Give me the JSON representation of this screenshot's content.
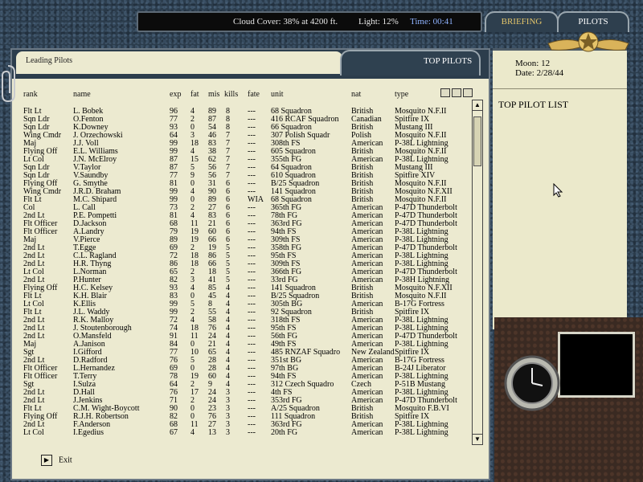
{
  "status_bar": {
    "cloud_cover": "Cloud Cover: 38% at 4200 ft.",
    "light": "Light: 12%",
    "time": "Time: 00:41"
  },
  "tabs": {
    "briefing": "BRIEFING",
    "pilots": "PILOTS"
  },
  "main": {
    "title": "Leading Pilots",
    "tab_label": "TOP PILOTS",
    "exit_label": "Exit"
  },
  "columns": [
    "rank",
    "name",
    "exp",
    "fat",
    "mis",
    "kills",
    "fate",
    "unit",
    "nat",
    "type"
  ],
  "info": {
    "moon": "Moon: 12",
    "date": "Date: 2/28/44",
    "list_title": "TOP PILOT LIST"
  },
  "pilots": [
    [
      "Flt Lt",
      "L. Bobek",
      "96",
      "4",
      "89",
      "8",
      "---",
      "68 Squadron",
      "British",
      "Mosquito N.F.II"
    ],
    [
      "Sqn Ldr",
      "O.Fenton",
      "77",
      "2",
      "87",
      "8",
      "---",
      "416 RCAF Squadron",
      "Canadian",
      "Spitfire IX"
    ],
    [
      "Sqn Ldr",
      "K.Downey",
      "93",
      "0",
      "54",
      "8",
      "---",
      "66 Squadron",
      "British",
      "Mustang III"
    ],
    [
      "Wing Cmdr",
      "J. Orzechowski",
      "64",
      "3",
      "46",
      "7",
      "---",
      "307 Polish Squadr",
      "Polish",
      "Mosquito N.F.II"
    ],
    [
      "Maj",
      "J.J. Voll",
      "99",
      "18",
      "83",
      "7",
      "---",
      "308th FS",
      "American",
      "P-38L Lightning"
    ],
    [
      "Flying Off",
      "E.L. Williams",
      "99",
      "4",
      "38",
      "7",
      "---",
      "605 Squadron",
      "British",
      "Mosquito N.F.II"
    ],
    [
      "Lt Col",
      "J.N. McElroy",
      "87",
      "15",
      "62",
      "7",
      "---",
      "355th FG",
      "American",
      "P-38L Lightning"
    ],
    [
      "Sqn Ldr",
      "V.Taylor",
      "87",
      "5",
      "56",
      "7",
      "---",
      "64 Squadron",
      "British",
      "Mustang III"
    ],
    [
      "Sqn Ldr",
      "V.Saundby",
      "77",
      "9",
      "56",
      "7",
      "---",
      "610 Squadron",
      "British",
      "Spitfire XIV"
    ],
    [
      "Flying Off",
      "G. Smythe",
      "81",
      "0",
      "31",
      "6",
      "---",
      "B/25 Squadron",
      "British",
      "Mosquito N.F.II"
    ],
    [
      "Wing Cmdr",
      "J.R.D. Braham",
      "99",
      "4",
      "90",
      "6",
      "---",
      "141 Squadron",
      "British",
      "Mosquito N.F.XII"
    ],
    [
      "Flt Lt",
      "M.C. Shipard",
      "99",
      "0",
      "89",
      "6",
      "WIA",
      "68 Squadron",
      "British",
      "Mosquito N.F.II"
    ],
    [
      "Col",
      "L. Call",
      "73",
      "2",
      "27",
      "6",
      "---",
      "365th FG",
      "American",
      "P-47D Thunderbolt"
    ],
    [
      "2nd Lt",
      "P.E. Pompetti",
      "81",
      "4",
      "83",
      "6",
      "---",
      "78th FG",
      "American",
      "P-47D Thunderbolt"
    ],
    [
      "Flt Officer",
      "D.Jackson",
      "68",
      "11",
      "21",
      "6",
      "---",
      "363rd FG",
      "American",
      "P-47D Thunderbolt"
    ],
    [
      "Flt Officer",
      "A.Landry",
      "79",
      "19",
      "60",
      "6",
      "---",
      "94th FS",
      "American",
      "P-38L Lightning"
    ],
    [
      "Maj",
      "V.Pierce",
      "89",
      "19",
      "66",
      "6",
      "---",
      "309th FS",
      "American",
      "P-38L Lightning"
    ],
    [
      "2nd Lt",
      "T.Egge",
      "69",
      "2",
      "19",
      "5",
      "---",
      "358th FG",
      "American",
      "P-47D Thunderbolt"
    ],
    [
      "2nd Lt",
      "C.L. Ragland",
      "72",
      "18",
      "86",
      "5",
      "---",
      "95th FS",
      "American",
      "P-38L Lightning"
    ],
    [
      "2nd Lt",
      "H.R. Thyng",
      "86",
      "18",
      "66",
      "5",
      "---",
      "309th FS",
      "American",
      "P-38L Lightning"
    ],
    [
      "Lt Col",
      "L.Norman",
      "65",
      "2",
      "18",
      "5",
      "---",
      "366th FG",
      "American",
      "P-47D Thunderbolt"
    ],
    [
      "2nd Lt",
      "P.Hunter",
      "82",
      "3",
      "41",
      "5",
      "---",
      "33rd FG",
      "American",
      "P-38H Lightning"
    ],
    [
      "Flying Off",
      "H.C. Kelsey",
      "93",
      "4",
      "85",
      "4",
      "---",
      "141 Squadron",
      "British",
      "Mosquito N.F.XII"
    ],
    [
      "Flt Lt",
      "K.H. Blair",
      "83",
      "0",
      "45",
      "4",
      "---",
      "B/25 Squadron",
      "British",
      "Mosquito N.F.II"
    ],
    [
      "Lt Col",
      "K.Ellis",
      "99",
      "5",
      "8",
      "4",
      "---",
      "305th BG",
      "American",
      "B-17G Fortress"
    ],
    [
      "Flt Lt",
      "J.L. Waddy",
      "99",
      "2",
      "55",
      "4",
      "---",
      "92 Squadron",
      "British",
      "Spitfire IX"
    ],
    [
      "2nd Lt",
      "R.K. Malloy",
      "72",
      "4",
      "58",
      "4",
      "---",
      "318th FS",
      "American",
      "P-38L Lightning"
    ],
    [
      "2nd Lt",
      "J. Stoutenborough",
      "74",
      "18",
      "76",
      "4",
      "---",
      "95th FS",
      "American",
      "P-38L Lightning"
    ],
    [
      "2nd Lt",
      "O.Mansfeld",
      "91",
      "11",
      "24",
      "4",
      "---",
      "56th FG",
      "American",
      "P-47D Thunderbolt"
    ],
    [
      "Maj",
      "A.Janison",
      "84",
      "0",
      "21",
      "4",
      "---",
      "49th FS",
      "American",
      "P-38L Lightning"
    ],
    [
      "Sgt",
      "I.Gifford",
      "77",
      "10",
      "65",
      "4",
      "---",
      "485 RNZAF Squadro",
      "New Zealand",
      "Spitfire IX"
    ],
    [
      "2nd Lt",
      "D.Radford",
      "76",
      "5",
      "28",
      "4",
      "---",
      "351st BG",
      "American",
      "B-17G Fortress"
    ],
    [
      "Flt Officer",
      "L.Hernandez",
      "69",
      "0",
      "28",
      "4",
      "---",
      "97th BG",
      "American",
      "B-24J Liberator"
    ],
    [
      "Flt Officer",
      "T.Terry",
      "78",
      "19",
      "60",
      "4",
      "---",
      "94th FS",
      "American",
      "P-38L Lightning"
    ],
    [
      "Sgt",
      "I.Sulza",
      "64",
      "2",
      "9",
      "4",
      "---",
      "312 Czech Squadro",
      "Czech",
      "P-51B Mustang"
    ],
    [
      "2nd Lt",
      "D.Hall",
      "76",
      "17",
      "24",
      "3",
      "---",
      "4th FS",
      "American",
      "P-38L Lightning"
    ],
    [
      "2nd Lt",
      "J.Jenkins",
      "71",
      "2",
      "24",
      "3",
      "---",
      "353rd FG",
      "American",
      "P-47D Thunderbolt"
    ],
    [
      "Flt Lt",
      "C.M. Wight-Boycott",
      "90",
      "0",
      "23",
      "3",
      "---",
      "A/25 Squadron",
      "British",
      "Mosquito F.B.VI"
    ],
    [
      "Flying Off",
      "R.J.H. Robertson",
      "82",
      "0",
      "76",
      "3",
      "---",
      "111 Squadron",
      "British",
      "Spitfire IX"
    ],
    [
      "2nd Lt",
      "F.Anderson",
      "68",
      "11",
      "27",
      "3",
      "---",
      "363rd FG",
      "American",
      "P-38L Lightning"
    ],
    [
      "Lt Col",
      "I.Egedius",
      "67",
      "4",
      "13",
      "3",
      "---",
      "20th FG",
      "American",
      "P-38L Lightning"
    ]
  ]
}
